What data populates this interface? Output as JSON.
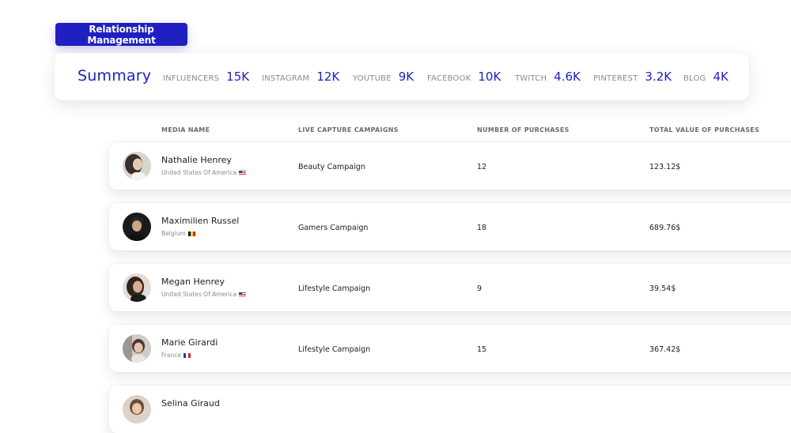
{
  "header": {
    "title": "Relationship Management"
  },
  "summary": {
    "title": "Summary",
    "stats": [
      {
        "label": "INFLUENCERS",
        "value": "15K"
      },
      {
        "label": "INSTAGRAM",
        "value": "12K"
      },
      {
        "label": "YOUTUBE",
        "value": "9K"
      },
      {
        "label": "FACEBOOK",
        "value": "10K"
      },
      {
        "label": "TWITCH",
        "value": "4.6K"
      },
      {
        "label": "PINTEREST",
        "value": "3.2K"
      },
      {
        "label": "BLOG",
        "value": "4K"
      }
    ]
  },
  "table": {
    "columns": [
      "MEDIA NAME",
      "LIVE CAPTURE CAMPAIGNS",
      "NUMBER OF PURCHASES",
      "TOTAL VALUE OF PURCHASES"
    ],
    "rows": [
      {
        "name": "Nathalie Henrey",
        "country": "United States Of America",
        "flag_icon": "us-flag-icon",
        "campaign": "Beauty Campaign",
        "purchases": "12",
        "total": "123.12$"
      },
      {
        "name": "Maximilien Russel",
        "country": "Belgium",
        "flag_icon": "belgium-flag-icon",
        "campaign": "Gamers Campaign",
        "purchases": "18",
        "total": "689.76$"
      },
      {
        "name": "Megan Henrey",
        "country": "United States Of America",
        "flag_icon": "us-flag-icon",
        "campaign": "Lifestyle Campaign",
        "purchases": "9",
        "total": "39.54$"
      },
      {
        "name": "Marie Girardi",
        "country": "France",
        "flag_icon": "france-flag-icon",
        "campaign": "Lifestyle Campaign",
        "purchases": "15",
        "total": "367.42$"
      },
      {
        "name": "Selina Giraud",
        "country": "",
        "flag_icon": "",
        "campaign": "",
        "purchases": "",
        "total": ""
      }
    ]
  },
  "colors": {
    "accent": "#1f1fc2",
    "muted": "#8a8a94",
    "text": "#1c1c24"
  }
}
